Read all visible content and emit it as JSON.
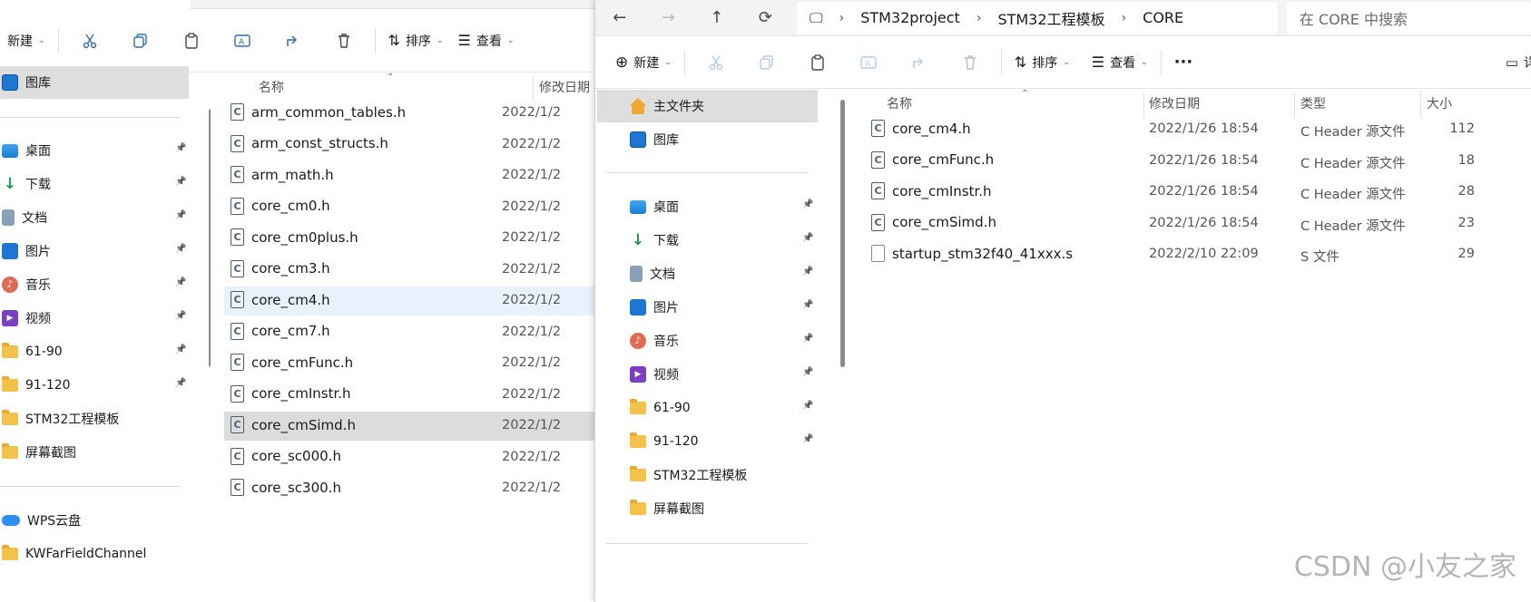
{
  "left": {
    "toolbar": {
      "new": "新建",
      "sort": "排序",
      "view": "查看"
    },
    "nav": [
      {
        "label": "图库",
        "icon": "gallery-icon",
        "selected": true
      },
      {
        "label": "桌面",
        "icon": "desktop-icon"
      },
      {
        "label": "下载",
        "icon": "download-icon"
      },
      {
        "label": "文档",
        "icon": "documents-icon"
      },
      {
        "label": "图片",
        "icon": "pictures-icon"
      },
      {
        "label": "音乐",
        "icon": "music-icon"
      },
      {
        "label": "视频",
        "icon": "videos-icon"
      },
      {
        "label": "61-90",
        "icon": "folder-icon"
      },
      {
        "label": "91-120",
        "icon": "folder-icon"
      },
      {
        "label": "STM32工程模板",
        "icon": "folder-icon"
      },
      {
        "label": "屏幕截图",
        "icon": "folder-icon"
      },
      {
        "label": "WPS云盘",
        "icon": "cloud-icon"
      },
      {
        "label": "KWFarFieldChannel",
        "icon": "folder-icon"
      }
    ],
    "columns": {
      "name": "名称",
      "modified": "修改日期"
    },
    "files": [
      {
        "name": "arm_common_tables.h",
        "date": "2022/1/2"
      },
      {
        "name": "arm_const_structs.h",
        "date": "2022/1/2"
      },
      {
        "name": "arm_math.h",
        "date": "2022/1/2"
      },
      {
        "name": "core_cm0.h",
        "date": "2022/1/2"
      },
      {
        "name": "core_cm0plus.h",
        "date": "2022/1/2"
      },
      {
        "name": "core_cm3.h",
        "date": "2022/1/2"
      },
      {
        "name": "core_cm4.h",
        "date": "2022/1/2"
      },
      {
        "name": "core_cm7.h",
        "date": "2022/1/2"
      },
      {
        "name": "core_cmFunc.h",
        "date": "2022/1/2"
      },
      {
        "name": "core_cmInstr.h",
        "date": "2022/1/2"
      },
      {
        "name": "core_cmSimd.h",
        "date": "2022/1/2"
      },
      {
        "name": "core_sc000.h",
        "date": "2022/1/2"
      },
      {
        "name": "core_sc300.h",
        "date": "2022/1/2"
      }
    ]
  },
  "right": {
    "address": {
      "crumbs": [
        "STM32project",
        "STM32工程模板",
        "CORE"
      ],
      "search_placeholder": "在 CORE 中搜索"
    },
    "toolbar": {
      "new": "新建",
      "sort": "排序",
      "view": "查看",
      "more": "···",
      "details": "详"
    },
    "nav": [
      {
        "label": "主文件夹",
        "icon": "home-icon",
        "selected": true
      },
      {
        "label": "图库",
        "icon": "gallery-icon"
      },
      {
        "label": "桌面",
        "icon": "desktop-icon"
      },
      {
        "label": "下载",
        "icon": "download-icon"
      },
      {
        "label": "文档",
        "icon": "documents-icon"
      },
      {
        "label": "图片",
        "icon": "pictures-icon"
      },
      {
        "label": "音乐",
        "icon": "music-icon"
      },
      {
        "label": "视频",
        "icon": "videos-icon"
      },
      {
        "label": "61-90",
        "icon": "folder-icon"
      },
      {
        "label": "91-120",
        "icon": "folder-icon"
      },
      {
        "label": "STM32工程模板",
        "icon": "folder-icon"
      },
      {
        "label": "屏幕截图",
        "icon": "folder-icon"
      }
    ],
    "columns": {
      "name": "名称",
      "modified": "修改日期",
      "type": "类型",
      "size": "大小"
    },
    "files": [
      {
        "name": "core_cm4.h",
        "date": "2022/1/26 18:54",
        "type": "C Header 源文件",
        "size": "112",
        "icon": "c-file-icon"
      },
      {
        "name": "core_cmFunc.h",
        "date": "2022/1/26 18:54",
        "type": "C Header 源文件",
        "size": "18",
        "icon": "c-file-icon"
      },
      {
        "name": "core_cmInstr.h",
        "date": "2022/1/26 18:54",
        "type": "C Header 源文件",
        "size": "28",
        "icon": "c-file-icon"
      },
      {
        "name": "core_cmSimd.h",
        "date": "2022/1/26 18:54",
        "type": "C Header 源文件",
        "size": "23",
        "icon": "c-file-icon"
      },
      {
        "name": "startup_stm32f40_41xxx.s",
        "date": "2022/2/10 22:09",
        "type": "S 文件",
        "size": "29",
        "icon": "s-file-icon"
      }
    ]
  },
  "watermark": "CSDN @小友之家"
}
